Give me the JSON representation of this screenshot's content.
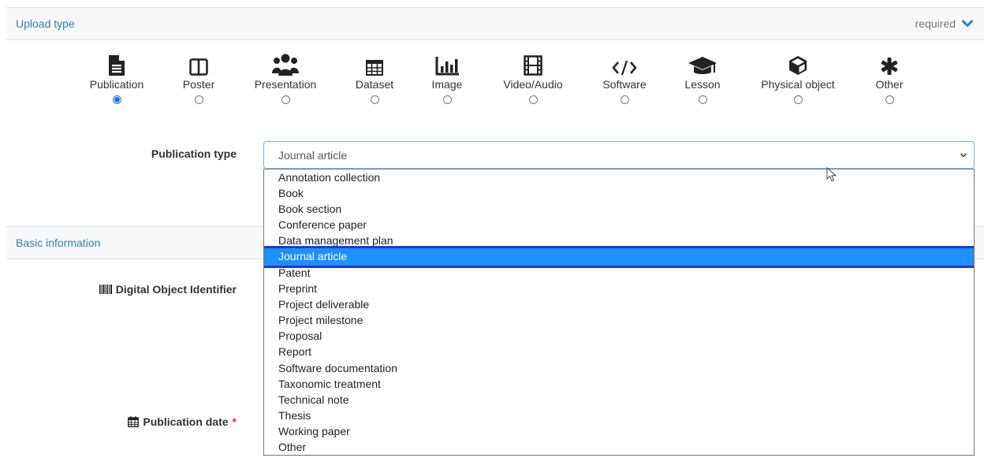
{
  "upload_type": {
    "title": "Upload type",
    "required_label": "required",
    "types": [
      {
        "label": "Publication",
        "icon": "file-text-icon",
        "checked": true
      },
      {
        "label": "Poster",
        "icon": "columns-icon",
        "checked": false
      },
      {
        "label": "Presentation",
        "icon": "group-icon",
        "checked": false
      },
      {
        "label": "Dataset",
        "icon": "table-icon",
        "checked": false
      },
      {
        "label": "Image",
        "icon": "bar-chart-icon",
        "checked": false
      },
      {
        "label": "Video/Audio",
        "icon": "film-icon",
        "checked": false
      },
      {
        "label": "Software",
        "icon": "code-icon",
        "checked": false
      },
      {
        "label": "Lesson",
        "icon": "graduation-cap-icon",
        "checked": false
      },
      {
        "label": "Physical object",
        "icon": "cube-icon",
        "checked": false
      },
      {
        "label": "Other",
        "icon": "asterisk-icon",
        "checked": false
      }
    ]
  },
  "publication_type": {
    "label": "Publication type",
    "value": "Journal article",
    "options": [
      "Annotation collection",
      "Book",
      "Book section",
      "Conference paper",
      "Data management plan",
      "Journal article",
      "Patent",
      "Preprint",
      "Project deliverable",
      "Project milestone",
      "Proposal",
      "Report",
      "Software documentation",
      "Taxonomic treatment",
      "Technical note",
      "Thesis",
      "Working paper",
      "Other"
    ],
    "selected_index": 5
  },
  "basic_information": {
    "title": "Basic information",
    "doi_label": "Digital Object Identifier",
    "pubdate_label": "Publication date",
    "required_mark": "*"
  },
  "colors": {
    "accent": "#2f7ec7",
    "selected_bg": "#1e90ff",
    "selected_outline": "#1a3fc9"
  }
}
